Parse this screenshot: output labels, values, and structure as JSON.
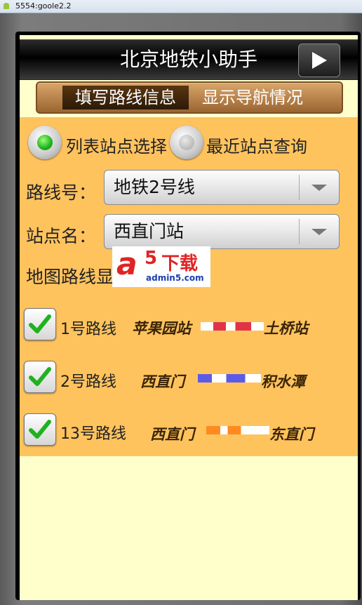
{
  "window": {
    "title": "5554:goole2.2"
  },
  "app": {
    "title": "北京地铁小助手",
    "play_icon": "play-icon"
  },
  "tabs": [
    {
      "label": "填写路线信息",
      "active": true
    },
    {
      "label": "显示导航情况",
      "active": false
    }
  ],
  "radios": [
    {
      "label": "列表站点选择",
      "checked": true
    },
    {
      "label": "最近站点查询",
      "checked": false
    }
  ],
  "route": {
    "label": "路线号：",
    "value": "地铁2号线"
  },
  "station": {
    "label": "站点名：",
    "value": "西直门站"
  },
  "map": {
    "title": "地图路线显示：",
    "lines": [
      {
        "label": "1号路线",
        "checked": true,
        "from": "苹果园站",
        "to": "土桥站",
        "color": "#e0334a"
      },
      {
        "label": "2号路线",
        "checked": true,
        "from": "西直门",
        "to": "积水潭",
        "color": "#5b5be8"
      },
      {
        "label": "13号路线",
        "checked": true,
        "from": "西直门",
        "to": "东直门",
        "color": "#ff8a1f"
      }
    ]
  },
  "watermark": {
    "logo": "a",
    "five": "5",
    "text": "下载",
    "url": "admin5.com"
  },
  "colors": {
    "panel": "#ffc35e",
    "background": "#ffffcc",
    "active_radio": "#1fb21f"
  }
}
